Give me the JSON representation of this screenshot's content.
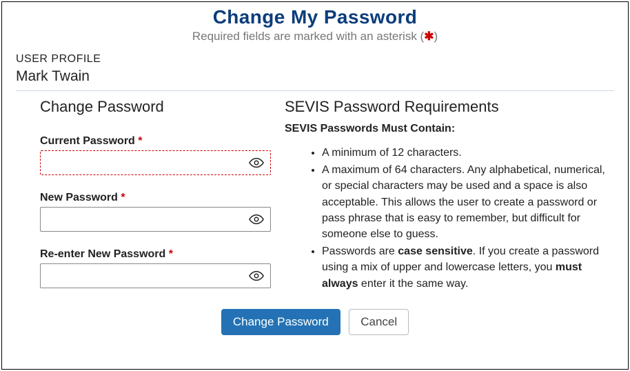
{
  "header": {
    "title": "Change My Password",
    "subtitle_prefix": "Required fields are marked with an asterisk (",
    "subtitle_asterisk": "✱",
    "subtitle_suffix": ")"
  },
  "profile": {
    "label": "USER PROFILE",
    "name": "Mark Twain"
  },
  "form": {
    "heading": "Change Password",
    "fields": {
      "current": {
        "label": "Current Password",
        "value": ""
      },
      "new": {
        "label": "New Password",
        "value": ""
      },
      "reenter": {
        "label": "Re-enter New Password",
        "value": ""
      }
    },
    "required_marker": " *"
  },
  "requirements": {
    "heading": "SEVIS Password Requirements",
    "subheading": "SEVIS Passwords Must Contain:",
    "items": [
      {
        "text": "A minimum of 12 characters."
      },
      {
        "text": "A maximum of 64 characters. Any alphabetical, numerical, or special characters may be used and a space is also acceptable. This allows the user to create a password or pass phrase that is easy to remember, but difficult for someone else to guess."
      },
      {
        "prefix": "Passwords are ",
        "strong1": "case sensitive",
        "mid": ". If you create a password using a mix of upper and lowercase letters, you ",
        "strong2": "must always",
        "suffix": " enter it the same way."
      }
    ]
  },
  "buttons": {
    "primary": "Change Password",
    "secondary": "Cancel"
  }
}
